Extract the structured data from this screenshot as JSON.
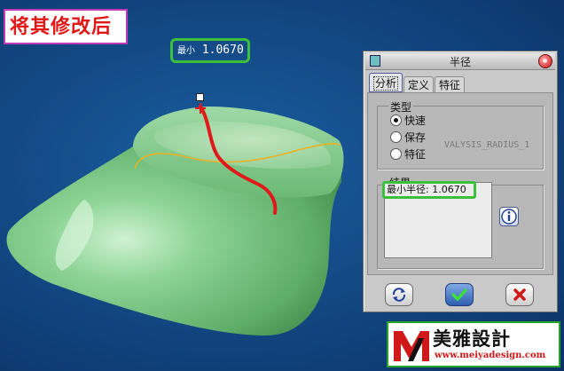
{
  "annotation": {
    "caption": "将其修改后"
  },
  "viewport": {
    "readout_label": "最小",
    "readout_value": "1.0670",
    "model_color": "#7fc98a",
    "curve_color": "#e01a1a",
    "section_color": "#f0b020"
  },
  "dialog": {
    "title": "半径",
    "tabs": [
      "分析",
      "定义",
      "特征"
    ],
    "active_tab": "分析",
    "type_group": {
      "title": "类型",
      "options": [
        {
          "label": "快速",
          "selected": true
        },
        {
          "label": "保存",
          "selected": false
        },
        {
          "label": "特征",
          "selected": false
        }
      ],
      "analysis_name": "VALYSIS_RADIUS_1"
    },
    "result_group": {
      "title": "结果",
      "result_text": "最小半径: 1.0670"
    },
    "icons": {
      "info": "info-icon",
      "refresh": "refresh-icon",
      "ok": "checkmark-icon",
      "cancel": "x-icon"
    }
  },
  "logo": {
    "name": "美雅設計",
    "url": "www.meiyadesign.com"
  }
}
